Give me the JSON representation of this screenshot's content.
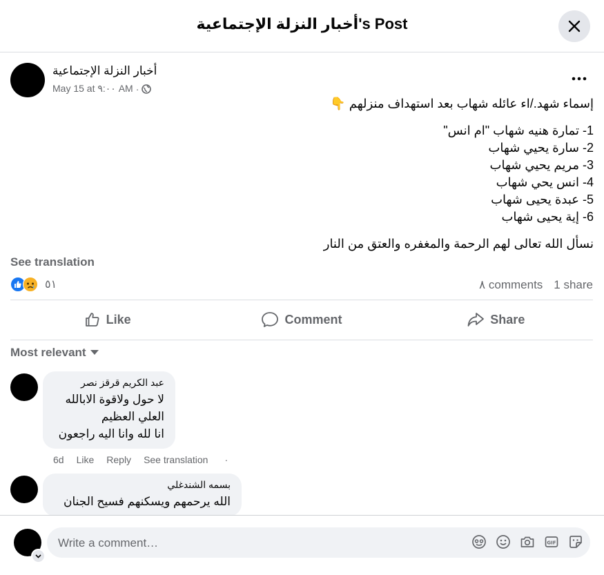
{
  "dialog": {
    "title": "أخبار النزلة الإجتماعية's Post"
  },
  "post": {
    "author": "أخبار النزلة الإجتماعية",
    "date": "May 15 at ٩:٠٠ AM",
    "separator": "·",
    "intro": "إسماء شهد./اء عائله شهاب بعد استهداف منزلهم 👇",
    "names": [
      "1- تمارة  هنيه شهاب  \"ام انس\"",
      "2- سارة يحيي شهاب",
      "3- مريم يحيي شهاب",
      "4- انس يحي شهاب",
      "5- عبدة  يحيى شهاب",
      "6- إية يحيى شهاب"
    ],
    "closing": "نسأل الله تعالى لهم الرحمة والمغفره والعتق من النار",
    "see_translation": "See translation",
    "reaction_count": "٥١",
    "comments_count": "٨ comments",
    "shares_count": "1 share"
  },
  "actions": {
    "like": "Like",
    "comment": "Comment",
    "share": "Share"
  },
  "comments_section": {
    "sort_label": "Most relevant",
    "comments": [
      {
        "author": "عبد الكريم قرقز نصر",
        "lines": [
          "لا حول ولاقوة الابالله",
          "العلي العظيم",
          "انا لله وانا اليه راجعون"
        ],
        "time": "6d",
        "like": "Like",
        "reply": "Reply",
        "see_translation": "See translation",
        "dot": "·"
      },
      {
        "author": "بسمه الشندغلي",
        "lines": [
          "الله يرحمهم ويسكنهم فسيح الجنان"
        ]
      }
    ]
  },
  "composer": {
    "placeholder": "Write a comment…"
  },
  "colors": {
    "like_blue": "#1877f2",
    "haha_yellow": "#f7b125",
    "muted_text": "#65676b",
    "bubble_bg": "#f0f2f5"
  },
  "icons": [
    "close-icon",
    "more-dots-icon",
    "globe-icon",
    "like-reaction-icon",
    "sad-reaction-icon",
    "thumbs-up-icon",
    "comment-bubble-icon",
    "share-arrow-icon",
    "caret-down-icon",
    "avatar-icon",
    "camera-icon",
    "gif-icon",
    "sticker-icon",
    "emoji-icon"
  ]
}
